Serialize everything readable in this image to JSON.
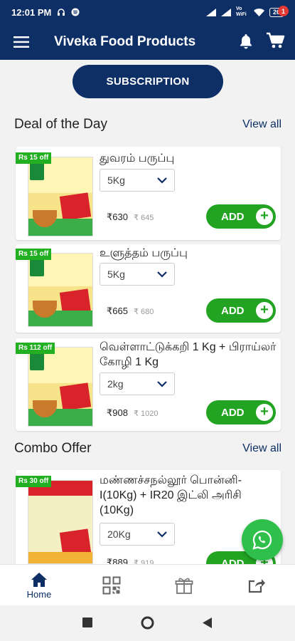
{
  "status_bar": {
    "time": "12:01 PM",
    "network_label": "Vo WiFi",
    "battery": "26"
  },
  "app_bar": {
    "title": "Viveka Food Products",
    "cart_count": "1"
  },
  "subscription": {
    "label": "SUBSCRIPTION"
  },
  "deal_section": {
    "title": "Deal of the Day",
    "view_all": "View all",
    "products": [
      {
        "offer": "Rs 15 off",
        "name": "துவரம் பருப்பு",
        "qty": "5Kg",
        "price": "₹630",
        "mrp": "₹ 645",
        "add_label": "ADD"
      },
      {
        "offer": "Rs 15 off",
        "name": "உளுத்தம் பருப்பு",
        "qty": "5Kg",
        "price": "₹665",
        "mrp": "₹ 680",
        "add_label": "ADD"
      },
      {
        "offer": "Rs 112 off",
        "name": "வெள்ளாட்டுக்கறி 1 Kg + பிராய்லர் கோழி 1 Kg",
        "qty": "2kg",
        "price": "₹908",
        "mrp": "₹ 1020",
        "add_label": "ADD"
      }
    ]
  },
  "combo_section": {
    "title": "Combo Offer",
    "view_all": "View all",
    "products": [
      {
        "offer": "Rs 30 off",
        "name": "மண்ணச்சநல்லூர் பொன்னி-I(10Kg) + IR20 இட்லி அரிசி (10Kg)",
        "qty": "20Kg",
        "price": "₹889",
        "mrp": "₹ 919",
        "add_label": "ADD"
      }
    ]
  },
  "bottom_nav": {
    "home_label": "Home"
  },
  "colors": {
    "primary": "#0d2f66",
    "accent_green": "#22a322",
    "offer_green": "#22b022",
    "whatsapp": "#2fc04c"
  }
}
